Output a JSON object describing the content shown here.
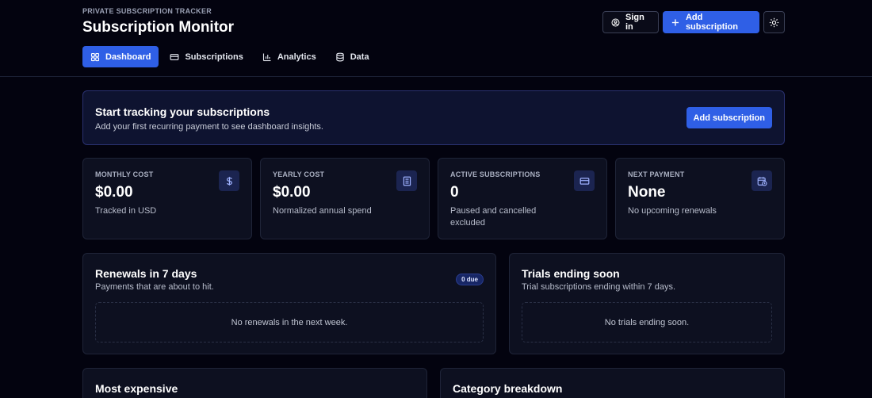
{
  "header": {
    "eyebrow": "PRIVATE SUBSCRIPTION TRACKER",
    "title": "Subscription Monitor",
    "sign_in": "Sign in",
    "add_subscription": "Add subscription",
    "tabs": [
      {
        "label": "Dashboard",
        "icon": "dashboard-icon",
        "active": true
      },
      {
        "label": "Subscriptions",
        "icon": "card-icon",
        "active": false
      },
      {
        "label": "Analytics",
        "icon": "bar-chart-icon",
        "active": false
      },
      {
        "label": "Data",
        "icon": "database-icon",
        "active": false
      }
    ]
  },
  "banner": {
    "title": "Start tracking your subscriptions",
    "subtitle": "Add your first recurring payment to see dashboard insights.",
    "button": "Add subscription"
  },
  "stats": [
    {
      "label": "MONTHLY COST",
      "value": "$0.00",
      "sub": "Tracked in USD",
      "icon": "dollar-icon"
    },
    {
      "label": "YEARLY COST",
      "value": "$0.00",
      "sub": "Normalized annual spend",
      "icon": "receipt-icon"
    },
    {
      "label": "ACTIVE SUBSCRIPTIONS",
      "value": "0",
      "sub": "Paused and cancelled excluded",
      "icon": "card-icon"
    },
    {
      "label": "NEXT PAYMENT",
      "value": "None",
      "sub": "No upcoming renewals",
      "icon": "calendar-clock-icon"
    }
  ],
  "renewals": {
    "title": "Renewals in 7 days",
    "subtitle": "Payments that are about to hit.",
    "badge": "0 due",
    "empty": "No renewals in the next week."
  },
  "trials": {
    "title": "Trials ending soon",
    "subtitle": "Trial subscriptions ending within 7 days.",
    "empty": "No trials ending soon."
  },
  "most_expensive": {
    "title": "Most expensive"
  },
  "category_breakdown": {
    "title": "Category breakdown"
  },
  "colors": {
    "accent": "#2f5fe6",
    "background": "#03030f",
    "card": "#0d1020"
  }
}
